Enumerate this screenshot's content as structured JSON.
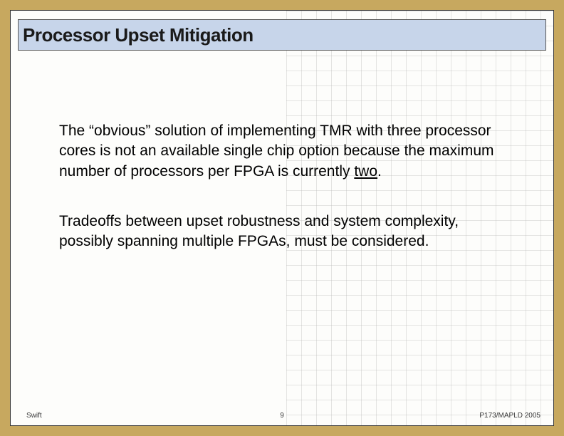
{
  "title": "Processor Upset Mitigation",
  "body": {
    "p1_a": "The “obvious” solution of implementing TMR with three processor cores is not an available single chip option because the maximum number of processors per FPGA is currently ",
    "p1_u": "two",
    "p1_b": ".",
    "p2": "Tradeoffs between upset robustness and system complexity, possibly spanning multiple FPGAs, must be considered."
  },
  "footer": {
    "left": "Swift",
    "center": "9",
    "right": "P173/MAPLD 2005"
  }
}
